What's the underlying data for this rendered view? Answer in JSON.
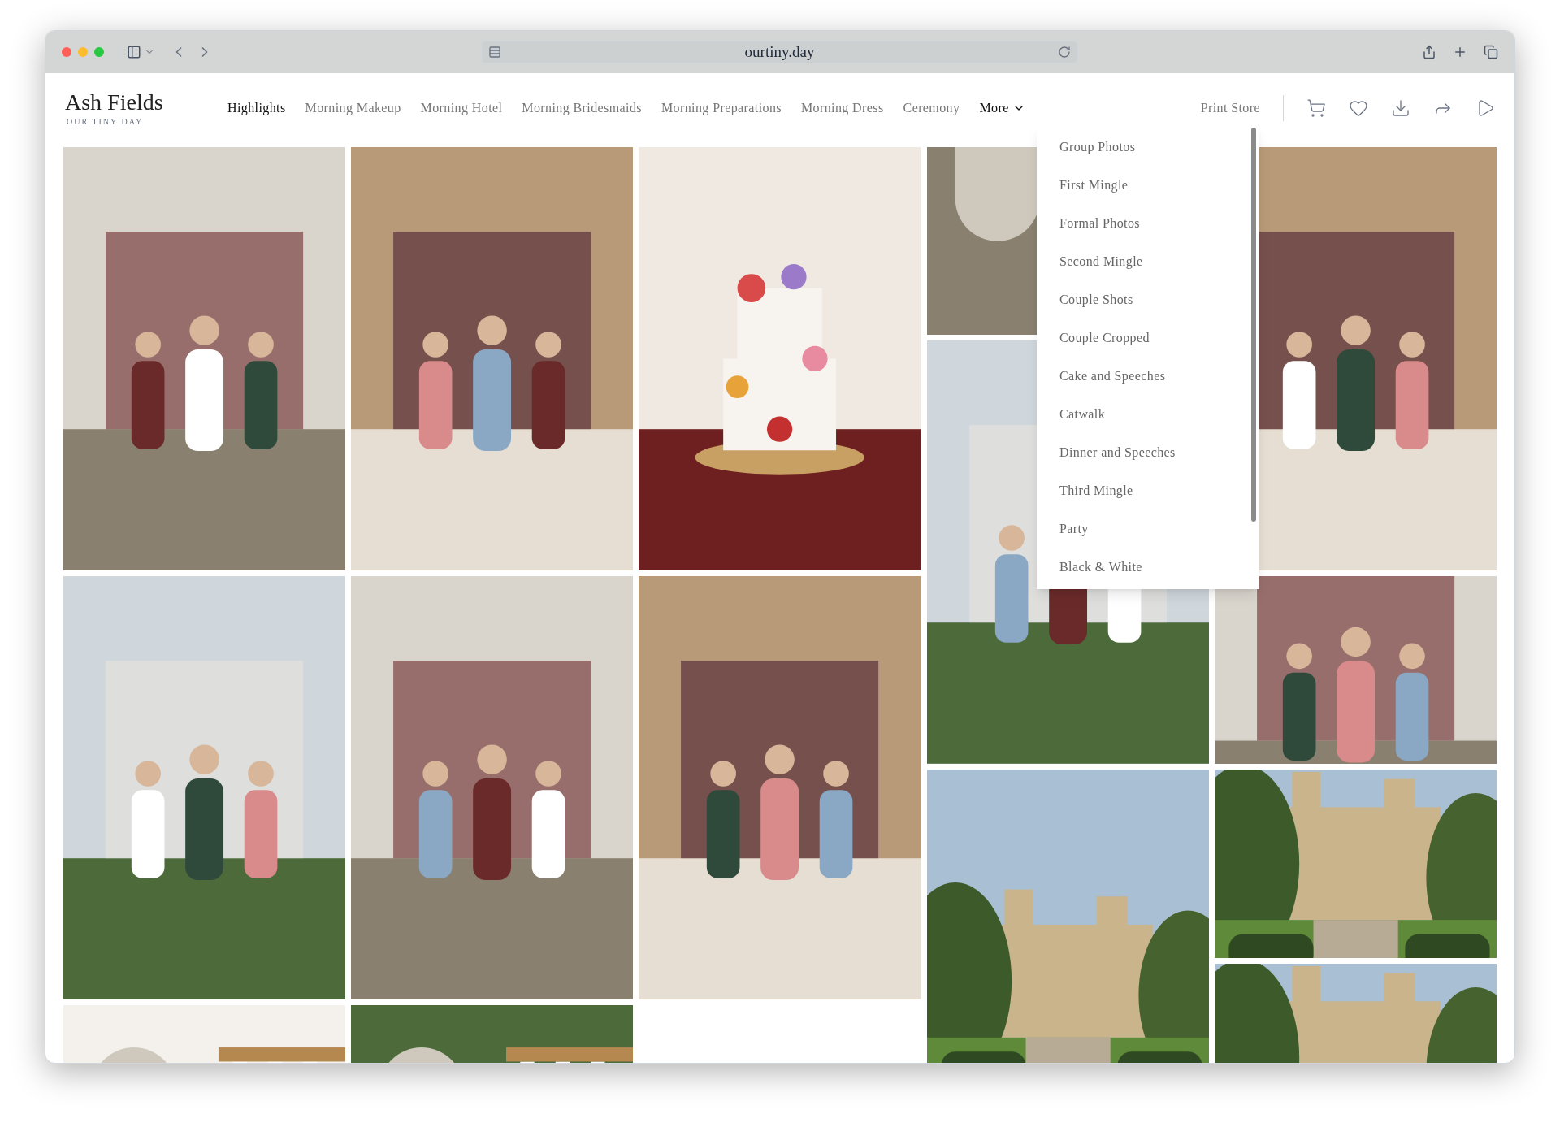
{
  "browser": {
    "url": "ourtiny.day"
  },
  "site": {
    "title": "Ash Fields",
    "subtitle": "OUR TINY DAY"
  },
  "nav": [
    {
      "label": "Highlights",
      "selected": true
    },
    {
      "label": "Morning Makeup",
      "selected": false
    },
    {
      "label": "Morning Hotel",
      "selected": false
    },
    {
      "label": "Morning Bridesmaids",
      "selected": false
    },
    {
      "label": "Morning Preparations",
      "selected": false
    },
    {
      "label": "Morning Dress",
      "selected": false
    },
    {
      "label": "Ceremony",
      "selected": false
    }
  ],
  "more": {
    "label": "More",
    "expanded": true,
    "items": [
      "Group Photos",
      "First Mingle",
      "Formal Photos",
      "Second Mingle",
      "Couple Shots",
      "Couple Cropped",
      "Cake and Speeches",
      "Catwalk",
      "Dinner and Speeches",
      "Third Mingle",
      "Party",
      "Black & White"
    ]
  },
  "print_store": "Print Store"
}
